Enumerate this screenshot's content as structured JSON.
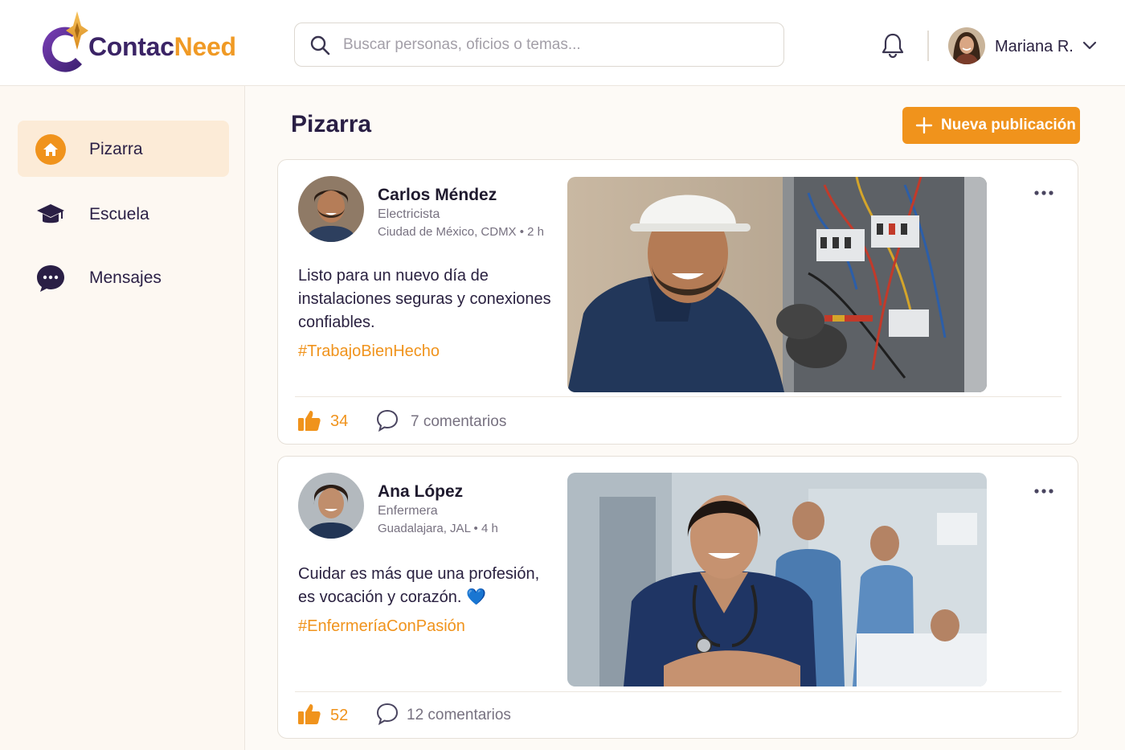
{
  "app": {
    "brand_part1": "Contac",
    "brand_part2": "Need"
  },
  "header": {
    "search_placeholder": "Buscar personas, oficios o temas...",
    "user_name": "Mariana R."
  },
  "sidebar": {
    "items": [
      {
        "label": "Pizarra",
        "icon": "home-icon",
        "active": true
      },
      {
        "label": "Escuela",
        "icon": "graduation-cap-icon",
        "active": false
      },
      {
        "label": "Mensajes",
        "icon": "chat-bubble-icon",
        "active": false
      }
    ]
  },
  "main": {
    "title": "Pizarra",
    "new_post_label": "Nueva publicación"
  },
  "posts": [
    {
      "author": "Carlos Méndez",
      "role": "Electricista",
      "location": "Ciudad de México, CDMX",
      "time": "2 h",
      "text": "Listo para un nuevo día de instalaciones seguras y conexiones confiables.",
      "hashtag": "#TrabajoBienHecho",
      "likes": "34",
      "comments": "7 comentarios"
    },
    {
      "author": "Ana López",
      "role": "Enfermera",
      "location": "Guadalajara, JAL",
      "time": "4 h",
      "text": "Cuidar es más que una profesión, es vocación y corazón. 💙",
      "hashtag": "#EnfermeríaConPasión",
      "likes": "52",
      "comments": "12 comentarios"
    }
  ],
  "colors": {
    "accent": "#f0931c",
    "brand_purple": "#3b2466",
    "active_nav_bg": "#fcebd7"
  }
}
